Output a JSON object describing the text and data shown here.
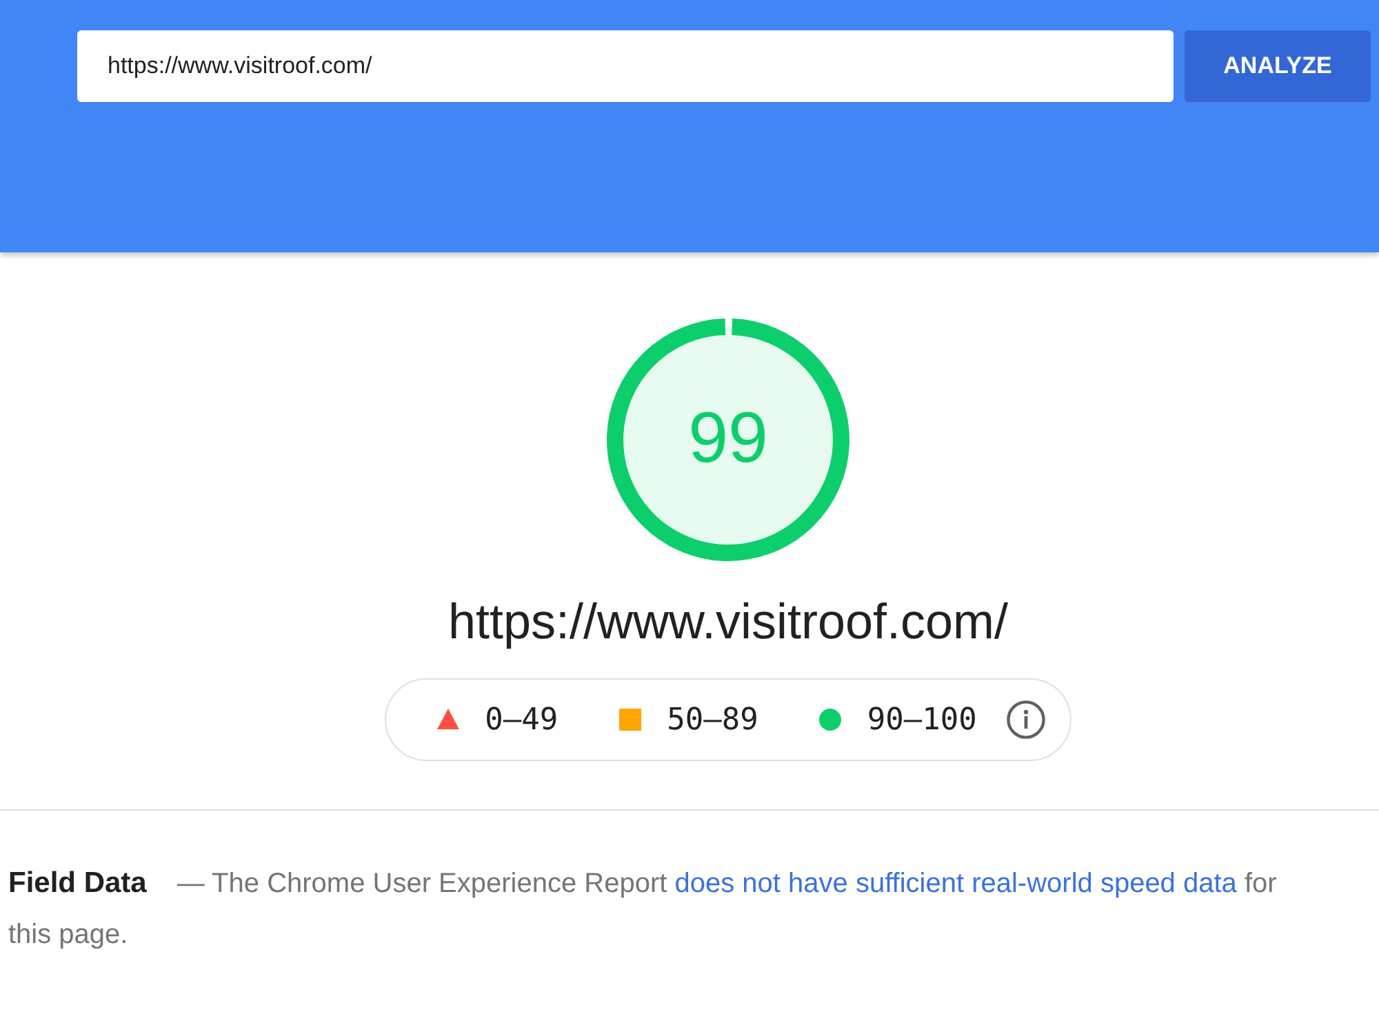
{
  "header": {
    "url_field": {
      "value": "https://www.visitroof.com/"
    },
    "analyze_button": "ANALYZE"
  },
  "score": {
    "value": "99",
    "level": 0.99
  },
  "url": "https://www.visitroof.com/",
  "legend": [
    {
      "kind": "triangle",
      "label": "0–49",
      "color": "#ff4e42"
    },
    {
      "kind": "square",
      "label": "50–89",
      "color": "#ffa400"
    },
    {
      "kind": "circle",
      "label": "90–100",
      "color": "#0cce6b"
    }
  ],
  "field_data": {
    "title": "Field Data",
    "text_before": "— The Chrome User Experience Report ",
    "link": "does not have sufficient real-world speed data",
    "text_after": " for this page."
  }
}
